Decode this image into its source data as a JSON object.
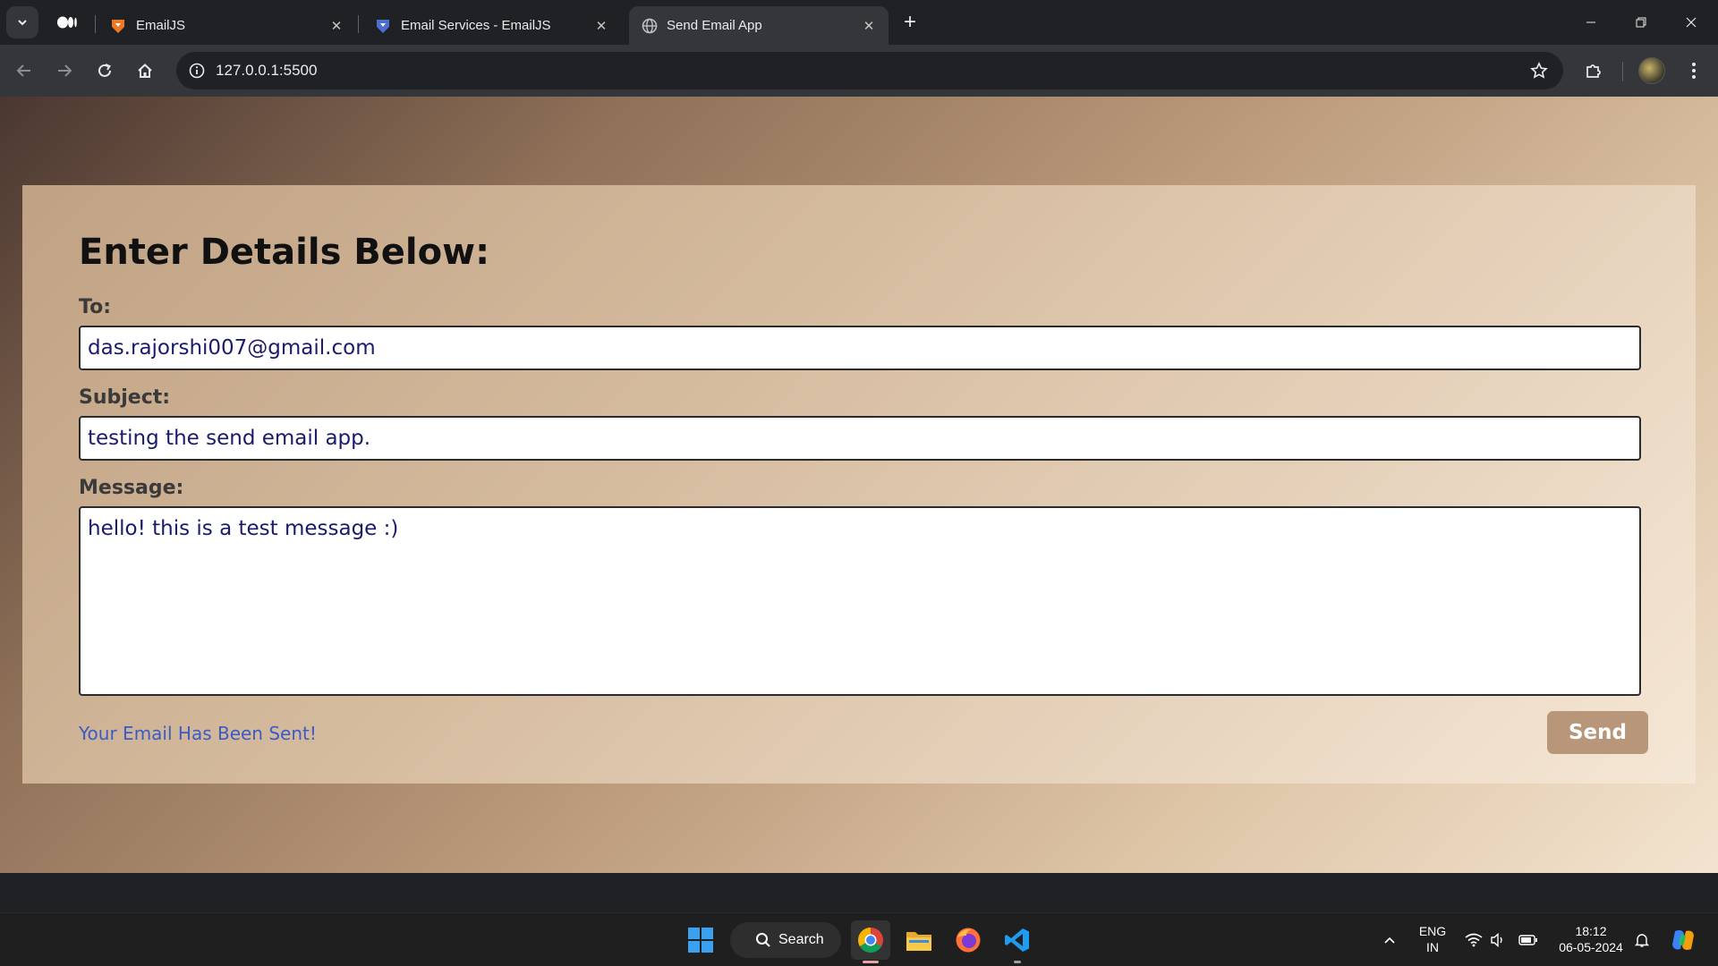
{
  "browser": {
    "tabs": [
      {
        "title": "EmailJS",
        "favicon": "emailjs-orange-icon"
      },
      {
        "title": "Email Services - EmailJS",
        "favicon": "emailjs-blue-icon"
      },
      {
        "title": "Send Email App",
        "favicon": "globe-icon",
        "active": true
      }
    ],
    "url": "127.0.0.1:5500"
  },
  "page": {
    "heading": "Enter Details Below:",
    "to_label": "To:",
    "to_value": "das.rajorshi007@gmail.com",
    "subject_label": "Subject:",
    "subject_value": "testing the send email app.",
    "message_label": "Message:",
    "message_value": "hello! this is a test message :)",
    "status_text": "Your Email Has Been Sent!",
    "send_label": "Send"
  },
  "taskbar": {
    "search_label": "Search",
    "lang_line1": "ENG",
    "lang_line2": "IN",
    "time": "18:12",
    "date": "06-05-2024"
  },
  "colors": {
    "status_text": "#3b5bc7",
    "send_button": "#b8967a",
    "input_text": "#1b1b6b"
  }
}
